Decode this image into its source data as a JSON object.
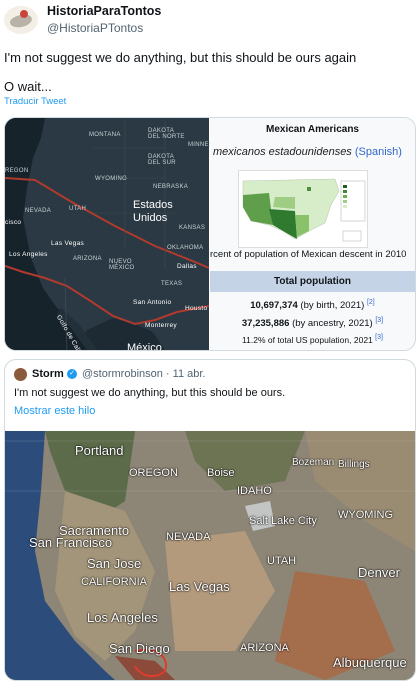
{
  "tweet": {
    "display_name": "HistoriaParaTontos",
    "handle": "@HistoriaPTontos",
    "text_line1": "I'm not suggest we do anything, but this should be ours again",
    "text_line2": "O wait...",
    "translate_link": "Traducir Tweet"
  },
  "dark_map": {
    "labels": {
      "dakota_norte": "DAKOTA\nDEL NORTE",
      "montana": "MONTANA",
      "minnes": "MINNES",
      "dakota_sur": "DAKOTA\nDEL SUR",
      "regon": "REGON",
      "wyoming": "WYOMING",
      "nebraska": "NEBRASKA",
      "nevada": "NEVADA",
      "utah": "UTAH",
      "estados_unidos": "Estados\nUnidos",
      "kansas": "KANSAS",
      "cisco": "cisco",
      "las_vegas": "Las Vegas",
      "los_angeles": "Los Angeles",
      "oklahoma": "OKLAHOMA",
      "arizona": "ARIZONA",
      "nuevo_mexico": "NUEVO\nMÉXICO",
      "dallas": "Dallas",
      "texas": "TEXAS",
      "golfo": "Golfo de California",
      "san_antonio": "San Antonio",
      "housto": "Housto",
      "monterrey": "Monterrey",
      "mexico": "México"
    }
  },
  "wiki_card": {
    "title": "Mexican Americans",
    "native_name": "mexicanos estadounidenses",
    "language": "(Spanish)",
    "map_caption": "rcent of population of Mexican descent in 2010",
    "section_title": "Total population",
    "rows": [
      {
        "value": "10,697,374",
        "note": "(by birth, 2021)",
        "ref": "[2]"
      },
      {
        "value": "37,235,886",
        "note": "(by ancestry, 2021)",
        "ref": "[3]"
      },
      {
        "value": "",
        "note": "11.2% of total US population, 2021",
        "ref": "[3]"
      }
    ]
  },
  "quoted_tweet": {
    "display_name": "Storm",
    "verified_icon": "check-badge-icon",
    "handle_date": "@stormrobinson · 11 abr.",
    "text": "I'm not suggest we do anything, but this should be ours.",
    "show_thread": "Mostrar este hilo",
    "map_labels": {
      "portland": "Portland",
      "oregon": "OREGON",
      "boise": "Boise",
      "bozeman": "Bozeman",
      "billings": "Billings",
      "idaho": "IDAHO",
      "wyoming": "WYOMING",
      "salt_lake_city": "Salt Lake City",
      "sacramento": "Sacramento",
      "san_francisco": "San Francisco",
      "nevada": "NEVADA",
      "utah": "UTAH",
      "san_jose": "San Jose",
      "california": "CALIFORNIA",
      "las_vegas": "Las Vegas",
      "denver": "Denver",
      "los_angeles": "Los Angeles",
      "san_diego": "San Diego",
      "arizona": "ARIZONA",
      "albuquerque": "Albuquerque"
    }
  }
}
